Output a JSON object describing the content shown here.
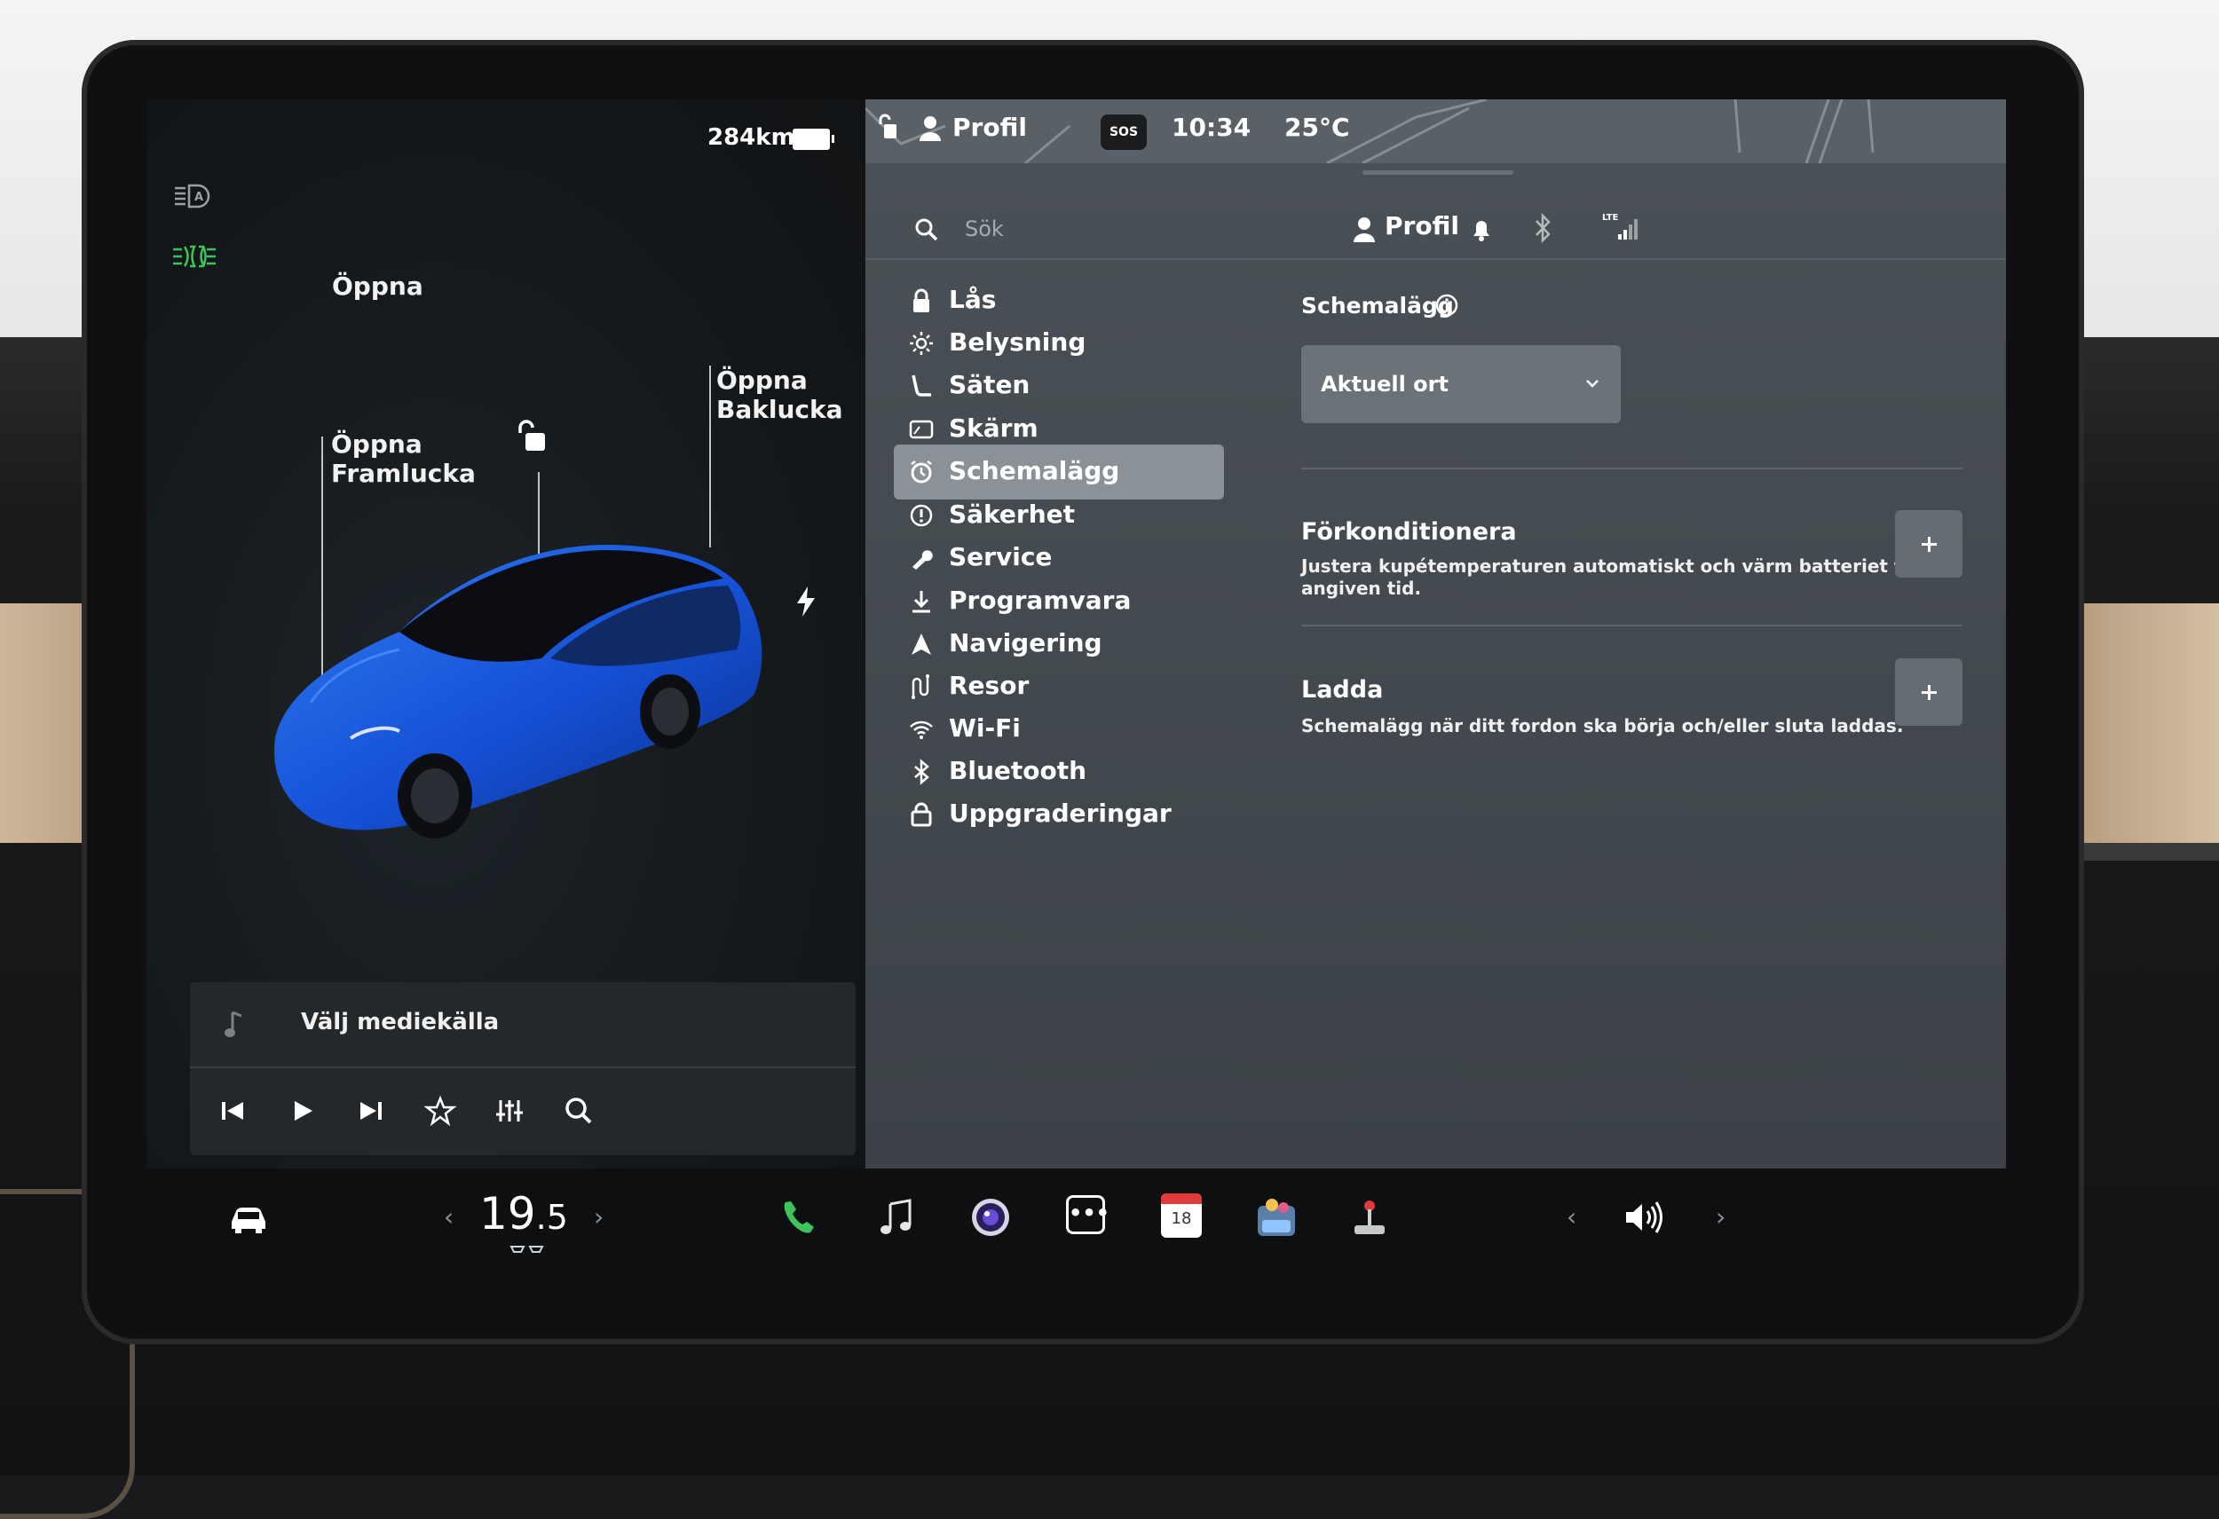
{
  "vehicle": {
    "range": "284km",
    "front_label_line1": "Öppna",
    "front_label_line2": "Framlucka",
    "trunk_label_line1": "Öppna",
    "trunk_label_line2": "Baklucka",
    "car_color": "#1f5fe0"
  },
  "media": {
    "source_label": "Välj mediekälla",
    "controls": [
      "previous-icon",
      "play-icon",
      "next-icon",
      "favorite-icon",
      "equalizer-icon",
      "search-icon"
    ]
  },
  "status_bar": {
    "profile": "Profil",
    "sos": "SOS",
    "time": "10:34",
    "outside_temp": "25°C"
  },
  "header": {
    "search_placeholder": "Sök",
    "profile": "Profil"
  },
  "nav": {
    "items": [
      {
        "label": "Lås",
        "icon": "lock-icon"
      },
      {
        "label": "Belysning",
        "icon": "sun-icon"
      },
      {
        "label": "Säten",
        "icon": "seat-icon"
      },
      {
        "label": "Skärm",
        "icon": "display-icon"
      },
      {
        "label": "Schemalägg",
        "icon": "schedule-icon",
        "selected": true
      },
      {
        "label": "Säkerhet",
        "icon": "safety-icon"
      },
      {
        "label": "Service",
        "icon": "wrench-icon"
      },
      {
        "label": "Programvara",
        "icon": "download-icon"
      },
      {
        "label": "Navigering",
        "icon": "navigation-icon"
      },
      {
        "label": "Resor",
        "icon": "trips-icon"
      },
      {
        "label": "Wi-Fi",
        "icon": "wifi-icon"
      },
      {
        "label": "Bluetooth",
        "icon": "bluetooth-icon"
      },
      {
        "label": "Uppgraderingar",
        "icon": "upgrades-icon"
      }
    ]
  },
  "content": {
    "schedule_title": "Schemalägg",
    "location_dropdown": "Aktuell ort",
    "precondition_title": "Förkonditionera",
    "precondition_desc_line1": "Justera kupétemperaturen automatiskt och värm batteriet till en",
    "precondition_desc_line2": "angiven tid.",
    "charge_title": "Ladda",
    "charge_desc": "Schemalägg när ditt fordon ska börja och/eller sluta laddas."
  },
  "taskbar": {
    "cabin_temp_main": "19",
    "cabin_temp_decimal": ".5",
    "calendar_day": "18",
    "accent_green": "#3ec45a"
  }
}
